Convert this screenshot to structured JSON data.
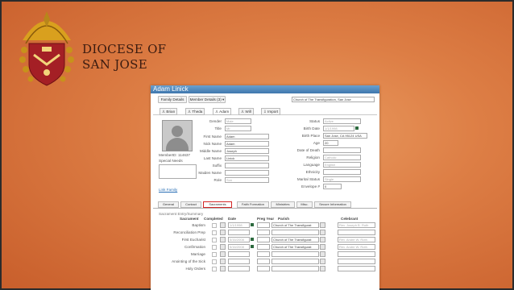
{
  "header": {
    "line1": "DIOCESE OF",
    "line2": "SAN JOSE"
  },
  "app": {
    "title": "Adam Linick",
    "family_button": "Family Details",
    "member_dropdown": "Member Details (3)",
    "parish_value": "Church of The Transfiguration, San Jose",
    "toolbar": [
      "Brian",
      "Theda",
      "Adam",
      "Will",
      "Import"
    ],
    "left_fields": [
      {
        "label": "Gender",
        "value": "Male"
      },
      {
        "label": "Title",
        "value": "Mr."
      },
      {
        "label": "First Name",
        "value": "Adam"
      },
      {
        "label": "Nick Name",
        "value": "Adam"
      },
      {
        "label": "Middle Name",
        "value": "Joseph"
      },
      {
        "label": "Last Name",
        "value": "Linick"
      },
      {
        "label": "Suffix",
        "value": ""
      },
      {
        "label": "Maiden Name",
        "value": ""
      },
      {
        "label": "Role",
        "value": "Son"
      }
    ],
    "right_fields": [
      {
        "label": "Status",
        "value": "Active"
      },
      {
        "label": "Birth Date",
        "value": "1/1/1998"
      },
      {
        "label": "Birth Place",
        "value": "San Jose, CA 95124 USA"
      },
      {
        "label": "Age",
        "value": "20"
      },
      {
        "label": "Date of Death",
        "value": ""
      },
      {
        "label": "Religion",
        "value": "Catholic"
      },
      {
        "label": "Language",
        "value": "English"
      },
      {
        "label": "Ethnicity",
        "value": ""
      },
      {
        "label": "Marital Status",
        "value": "Single"
      },
      {
        "label": "Envelope #",
        "value": "0"
      }
    ],
    "member_id": "MemberID: 114637",
    "special_needs": "Special Needs",
    "link_family": "Link Family",
    "tabs": [
      "General",
      "Contact",
      "Sacraments",
      "Faith Formation",
      "Ministries",
      "Misc.",
      "Secure Information"
    ],
    "section_title": "Sacrament Entry/Summary",
    "columns": [
      "Sacrament",
      "Completed",
      "Date",
      "Preg Year",
      "Parish",
      "Celebrant"
    ],
    "rows": [
      {
        "name": "Baptism",
        "date": "1/1/1998",
        "parish": "Church of The Transfigurat",
        "celebrant": "Rev. Joseph B. Roth"
      },
      {
        "name": "Reconciliation Prep",
        "date": "",
        "parish": "",
        "celebrant": ""
      },
      {
        "name": "First Eucharist",
        "date": "5/16/2008",
        "parish": "Church of The Transfigurat",
        "celebrant": "Rev. Andre W. Roth"
      },
      {
        "name": "Confirmation",
        "date": "5/16/2008",
        "parish": "Church of The Transfigurat",
        "celebrant": "Rev. Andre W. Roth"
      },
      {
        "name": "Marriage",
        "date": "",
        "parish": "",
        "celebrant": ""
      },
      {
        "name": "Anointing of the Sick",
        "date": "",
        "parish": "",
        "celebrant": ""
      },
      {
        "name": "Holy Orders",
        "date": "",
        "parish": "",
        "celebrant": ""
      }
    ]
  }
}
